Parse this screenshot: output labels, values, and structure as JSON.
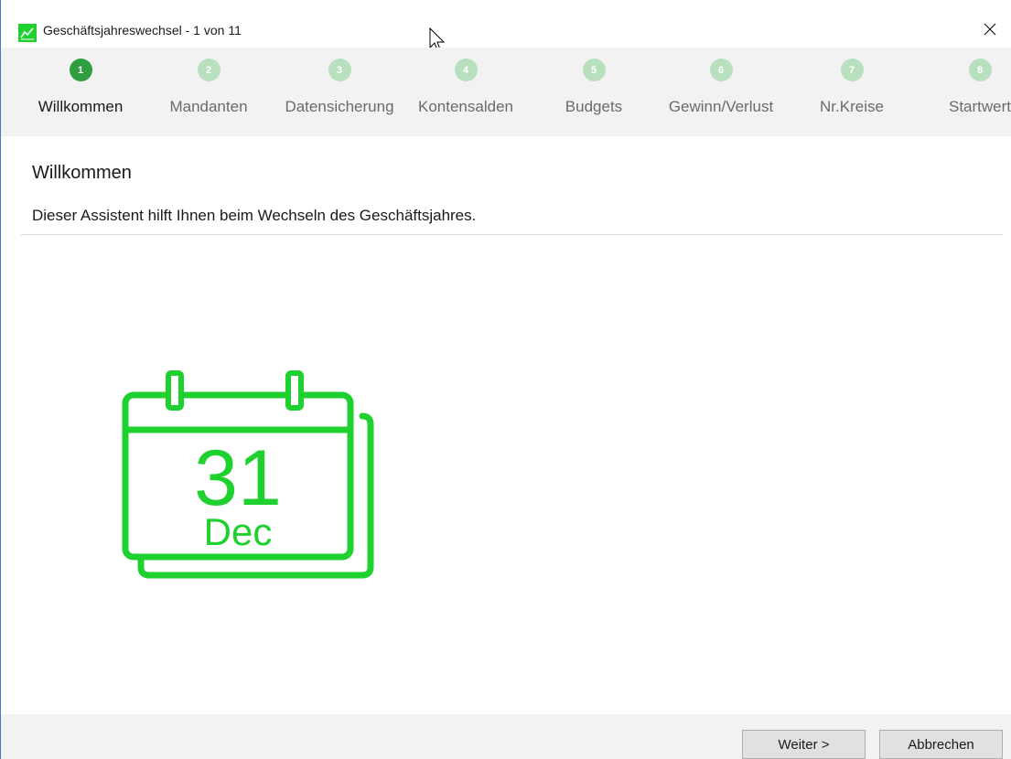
{
  "window": {
    "title": "Geschäftsjahreswechsel - 1 von 11",
    "close_symbol": "×",
    "app_icon": "chart-icon"
  },
  "steps": [
    {
      "number": "1",
      "label": "Willkommen",
      "active": true
    },
    {
      "number": "2",
      "label": "Mandanten",
      "active": false
    },
    {
      "number": "3",
      "label": "Datensicherung",
      "active": false
    },
    {
      "number": "4",
      "label": "Kontensalden",
      "active": false
    },
    {
      "number": "5",
      "label": "Budgets",
      "active": false
    },
    {
      "number": "6",
      "label": "Gewinn/Verlust",
      "active": false
    },
    {
      "number": "7",
      "label": "Nr.Kreise",
      "active": false
    },
    {
      "number": "8",
      "label": "Startwert",
      "active": false
    }
  ],
  "content": {
    "heading": "Willkommen",
    "description": "Dieser Assistent hilft Ihnen beim Wechseln des Geschäftsjahres."
  },
  "calendar": {
    "day": "31",
    "month": "Dec",
    "color": "#1fd12f"
  },
  "buttons": {
    "next_label": "Weiter >",
    "cancel_label": "Abbrechen"
  },
  "colors": {
    "accent": "#2e9e3f",
    "inactive_step": "#b8e0bf"
  }
}
